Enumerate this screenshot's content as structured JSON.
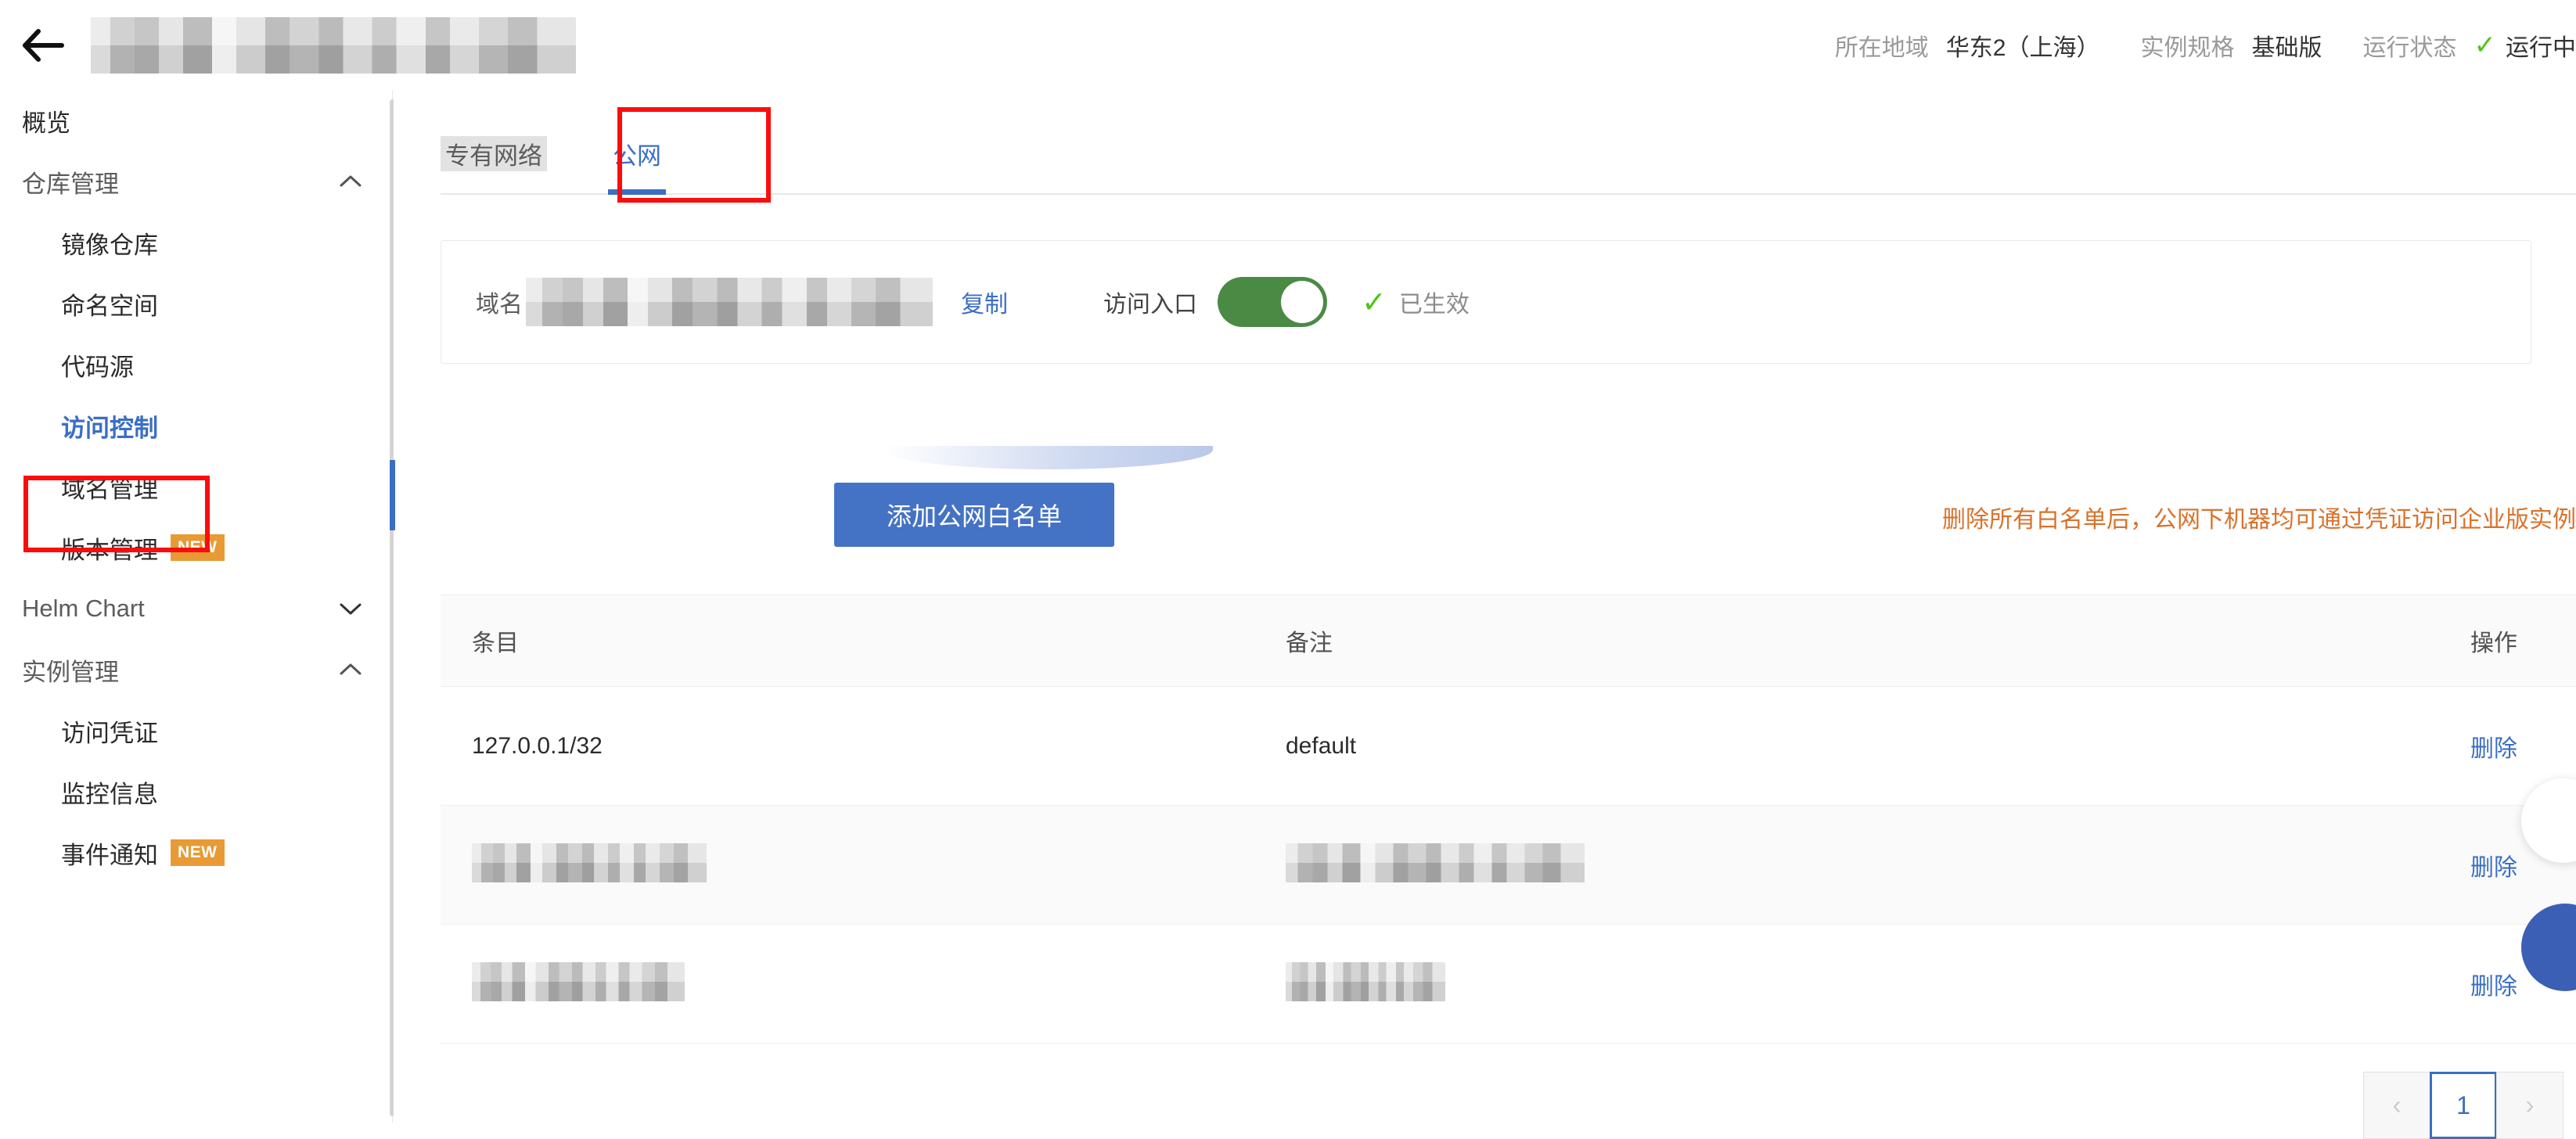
{
  "header": {
    "back_icon": "back-arrow-icon",
    "title_redacted": true,
    "meta": [
      {
        "label": "所在地域",
        "value": "华东2（上海）"
      },
      {
        "label": "实例规格",
        "value": "基础版"
      }
    ],
    "status_label": "运行状态",
    "status_check": "✓",
    "status_value": "运行中",
    "status_color": "#52c41a"
  },
  "sidebar": {
    "overview": "概览",
    "groups": [
      {
        "title": "仓库管理",
        "expanded": true,
        "chevron": "chevron-up-icon",
        "items": [
          {
            "label": "镜像仓库",
            "badge": ""
          },
          {
            "label": "命名空间",
            "badge": ""
          },
          {
            "label": "代码源",
            "badge": ""
          },
          {
            "label": "访问控制",
            "badge": "",
            "active": true
          },
          {
            "label": "域名管理",
            "badge": ""
          },
          {
            "label": "版本管理",
            "badge": "NEW"
          }
        ]
      },
      {
        "title": "Helm Chart",
        "expanded": false,
        "chevron": "chevron-down-icon",
        "items": []
      },
      {
        "title": "实例管理",
        "expanded": true,
        "chevron": "chevron-up-icon",
        "items": [
          {
            "label": "访问凭证",
            "badge": ""
          },
          {
            "label": "监控信息",
            "badge": ""
          },
          {
            "label": "事件通知",
            "badge": "NEW"
          }
        ]
      }
    ],
    "active_color": "#3b6ec4",
    "badge_color": "#e89a34"
  },
  "tabs": [
    {
      "label": "专有网络",
      "active": false
    },
    {
      "label": "公网",
      "active": true
    }
  ],
  "domain_card": {
    "label": "域名",
    "value_redacted": true,
    "copy_label": "复制",
    "entry_label": "访问入口",
    "toggle_on": true,
    "toggle_color": "#4a8a45",
    "effective_check": "✓",
    "effective_text": "已生效"
  },
  "actions": {
    "add_whitelist_label": "添加公网白名单",
    "add_whitelist_color": "#4472c4",
    "warning_text": "删除所有白名单后，公网下机器均可通过凭证访问企业版实例",
    "warning_color": "#d9722b"
  },
  "table": {
    "columns": [
      "条目",
      "备注",
      "操作"
    ],
    "rows": [
      {
        "entry": "127.0.0.1/32",
        "entry_redacted": false,
        "remark": "default",
        "remark_redacted": false,
        "action": "删除"
      },
      {
        "entry": "",
        "entry_redacted": true,
        "remark": "",
        "remark_redacted": true,
        "action": "删除"
      },
      {
        "entry": "",
        "entry_redacted": true,
        "remark": "",
        "remark_redacted": true,
        "action": "删除"
      }
    ]
  },
  "pagination": {
    "prev": "‹",
    "current_page": "1",
    "next": "›"
  },
  "annotations": {
    "color": "#fb0d0d",
    "boxes": [
      "sidebar-item-access-control",
      "tab-public"
    ]
  }
}
